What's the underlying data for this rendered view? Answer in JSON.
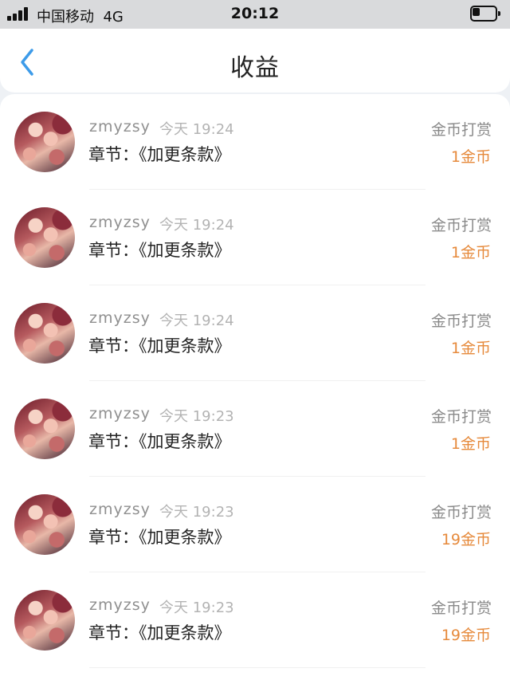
{
  "status_bar": {
    "carrier": "中国移动",
    "network": "4G",
    "time": "20:12"
  },
  "nav": {
    "title": "收益"
  },
  "records": [
    {
      "username": "zmyzsy",
      "time": "今天 19:24",
      "chapter": "章节：《加更条款》",
      "type": "金币打赏",
      "amount": "1金币"
    },
    {
      "username": "zmyzsy",
      "time": "今天 19:24",
      "chapter": "章节：《加更条款》",
      "type": "金币打赏",
      "amount": "1金币"
    },
    {
      "username": "zmyzsy",
      "time": "今天 19:24",
      "chapter": "章节：《加更条款》",
      "type": "金币打赏",
      "amount": "1金币"
    },
    {
      "username": "zmyzsy",
      "time": "今天 19:23",
      "chapter": "章节：《加更条款》",
      "type": "金币打赏",
      "amount": "1金币"
    },
    {
      "username": "zmyzsy",
      "time": "今天 19:23",
      "chapter": "章节：《加更条款》",
      "type": "金币打赏",
      "amount": "19金币"
    },
    {
      "username": "zmyzsy",
      "time": "今天 19:23",
      "chapter": "章节：《加更条款》",
      "type": "金币打赏",
      "amount": "19金币"
    }
  ],
  "colors": {
    "accent": "#3d9be9",
    "amount": "#e68a3c",
    "status_bar_bg": "#d9dadc"
  },
  "icons": {
    "back": "chevron-left-icon",
    "signal": "signal-icon",
    "battery": "battery-icon"
  }
}
